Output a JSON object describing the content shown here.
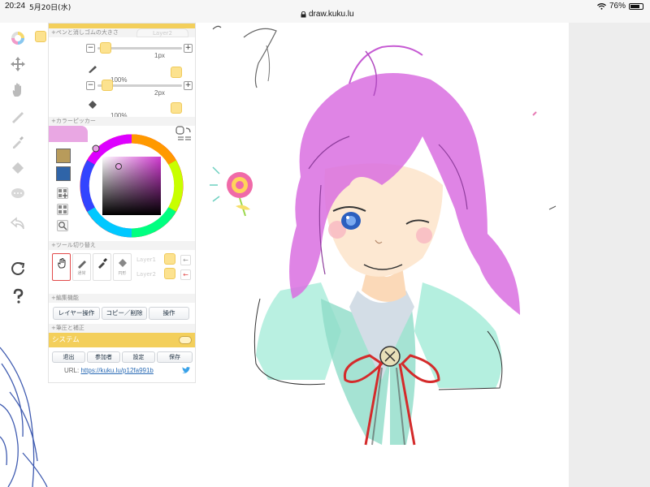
{
  "statusbar": {
    "time": "20:24",
    "date": "5月20日(水)",
    "url": "draw.kuku.lu",
    "battery": "76%"
  },
  "panel": {
    "pen_section_label": "+ペンと消しゴムの大きさ",
    "layer2_tab": "Layer2",
    "pen": {
      "size": "1px",
      "opacity": "100%",
      "size_pct": 0.03,
      "opacity_pct": 1.0
    },
    "eraser": {
      "size": "2px",
      "opacity": "100%",
      "size_pct": 0.06,
      "opacity_pct": 1.0
    },
    "picker_label": "+カラーピッカー",
    "colors": {
      "current": "#e9a7e3",
      "swatch1": "#b89b5b",
      "swatch2": "#2f64a8"
    },
    "toolswitch_label": "+ツール切り替え",
    "tool_labels": {
      "pen": "通常",
      "eyedrop": "円形"
    },
    "layer_a": "Layer1",
    "layer_b": "Layer2",
    "edit_label": "+編集機能",
    "edit_buttons": {
      "layer_ops": "レイヤー操作",
      "copy_delete": "コピー／削除",
      "ops": "操作"
    },
    "correction_label": "+筆圧と補正",
    "system_label": "システム",
    "system_buttons": {
      "exit": "退出",
      "participants": "参加者",
      "settings": "設定",
      "save": "保存"
    },
    "url_label": "URL:",
    "url_value": "https://kuku.lu/p12fa991b"
  }
}
